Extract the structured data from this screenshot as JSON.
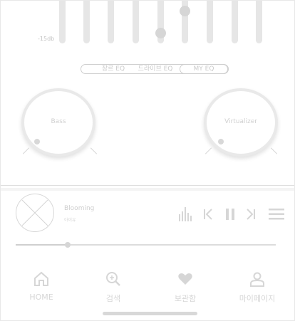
{
  "equalizer": {
    "db_label": "-15db",
    "tabs": [
      {
        "label": "장르 EQ",
        "active": false
      },
      {
        "label": "드라이브 EQ",
        "active": false
      },
      {
        "label": "MY EQ",
        "active": true
      }
    ]
  },
  "knobs": {
    "bass_label": "Bass",
    "virtualizer_label": "Virtualizer"
  },
  "player": {
    "song_title": "Blooming",
    "artist": "아이유",
    "progress": 0.2
  },
  "nav": {
    "items": [
      {
        "label": "HOME",
        "icon": "home-icon"
      },
      {
        "label": "검색",
        "icon": "search-icon"
      },
      {
        "label": "보관함",
        "icon": "heart-icon"
      },
      {
        "label": "마이페이지",
        "icon": "user-icon"
      }
    ]
  }
}
